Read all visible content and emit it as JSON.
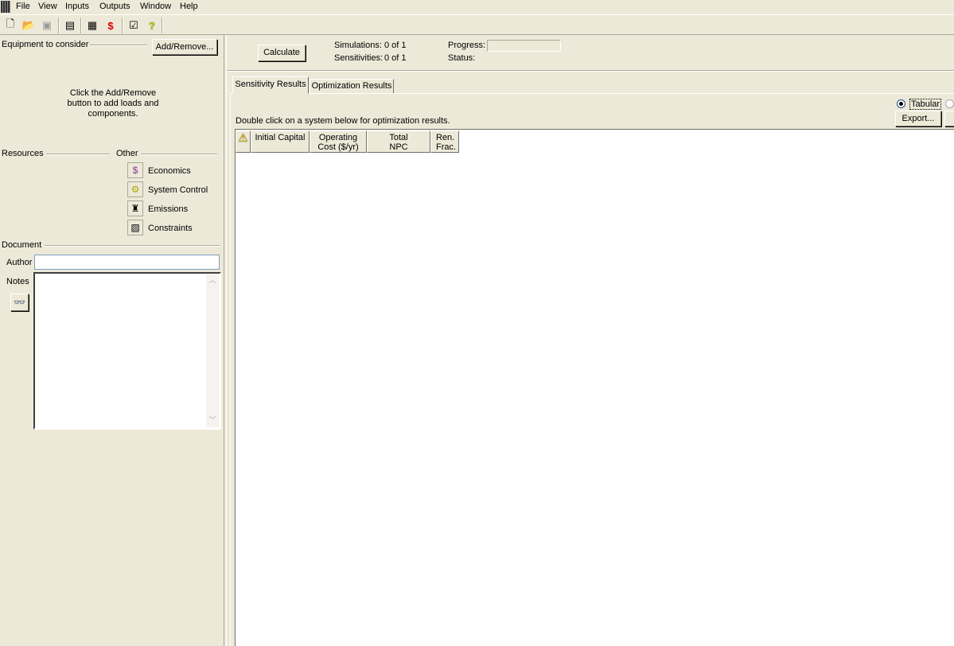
{
  "menu": [
    "File",
    "View",
    "Inputs",
    "Outputs",
    "Window",
    "Help"
  ],
  "toolbar": {
    "icons": [
      "new-file-icon",
      "open-folder-icon",
      "save-icon",
      "report-icon",
      "table-icon",
      "cost-table-icon",
      "properties-icon",
      "help-icon"
    ]
  },
  "left": {
    "equipment_label": "Equipment to consider",
    "add_remove": "Add/Remove...",
    "hint": "Click the Add/Remove button to add loads and components.",
    "resources_label": "Resources",
    "other_label": "Other",
    "other_items": [
      {
        "label": "Economics",
        "icon": "economics-icon"
      },
      {
        "label": "System Control",
        "icon": "system-control-icon"
      },
      {
        "label": "Emissions",
        "icon": "emissions-icon"
      },
      {
        "label": "Constraints",
        "icon": "constraints-icon"
      }
    ],
    "document_label": "Document",
    "author_label": "Author",
    "author_value": "",
    "notes_label": "Notes",
    "notes_value": ""
  },
  "top": {
    "calculate": "Calculate",
    "simulations_label": "Simulations:",
    "simulations_value": "0 of 1",
    "sensitivities_label": "Sensitivities:",
    "sensitivities_value": "0 of 1",
    "progress_label": "Progress:",
    "progress": 0,
    "status_label": "Status:",
    "status_value": ""
  },
  "tabs": [
    "Sensitivity Results",
    "Optimization Results"
  ],
  "results": {
    "instruction": "Double click on a system below for optimization results.",
    "view_mode": "Tabular",
    "export": "Export...",
    "columns": [
      "Initial Capital",
      "Operating Cost ($/yr)",
      "Total NPC",
      "Ren. Frac."
    ]
  }
}
